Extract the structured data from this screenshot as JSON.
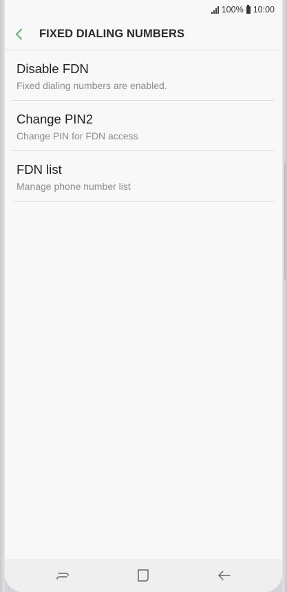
{
  "status_bar": {
    "battery_percent": "100%",
    "time": "10:00",
    "icons": [
      "signal-icon",
      "battery-icon"
    ]
  },
  "app_bar": {
    "title": "FIXED DIALING NUMBERS",
    "back_icon": "chevron-left-icon",
    "accent_color": "#4caf50"
  },
  "settings": {
    "items": [
      {
        "title": "Disable FDN",
        "subtitle": "Fixed dialing numbers are enabled."
      },
      {
        "title": "Change PIN2",
        "subtitle": "Change PIN for FDN access"
      },
      {
        "title": "FDN list",
        "subtitle": "Manage phone number list"
      }
    ]
  },
  "nav_bar": {
    "buttons": [
      "recent-apps-icon",
      "home-icon",
      "back-arrow-icon"
    ]
  }
}
